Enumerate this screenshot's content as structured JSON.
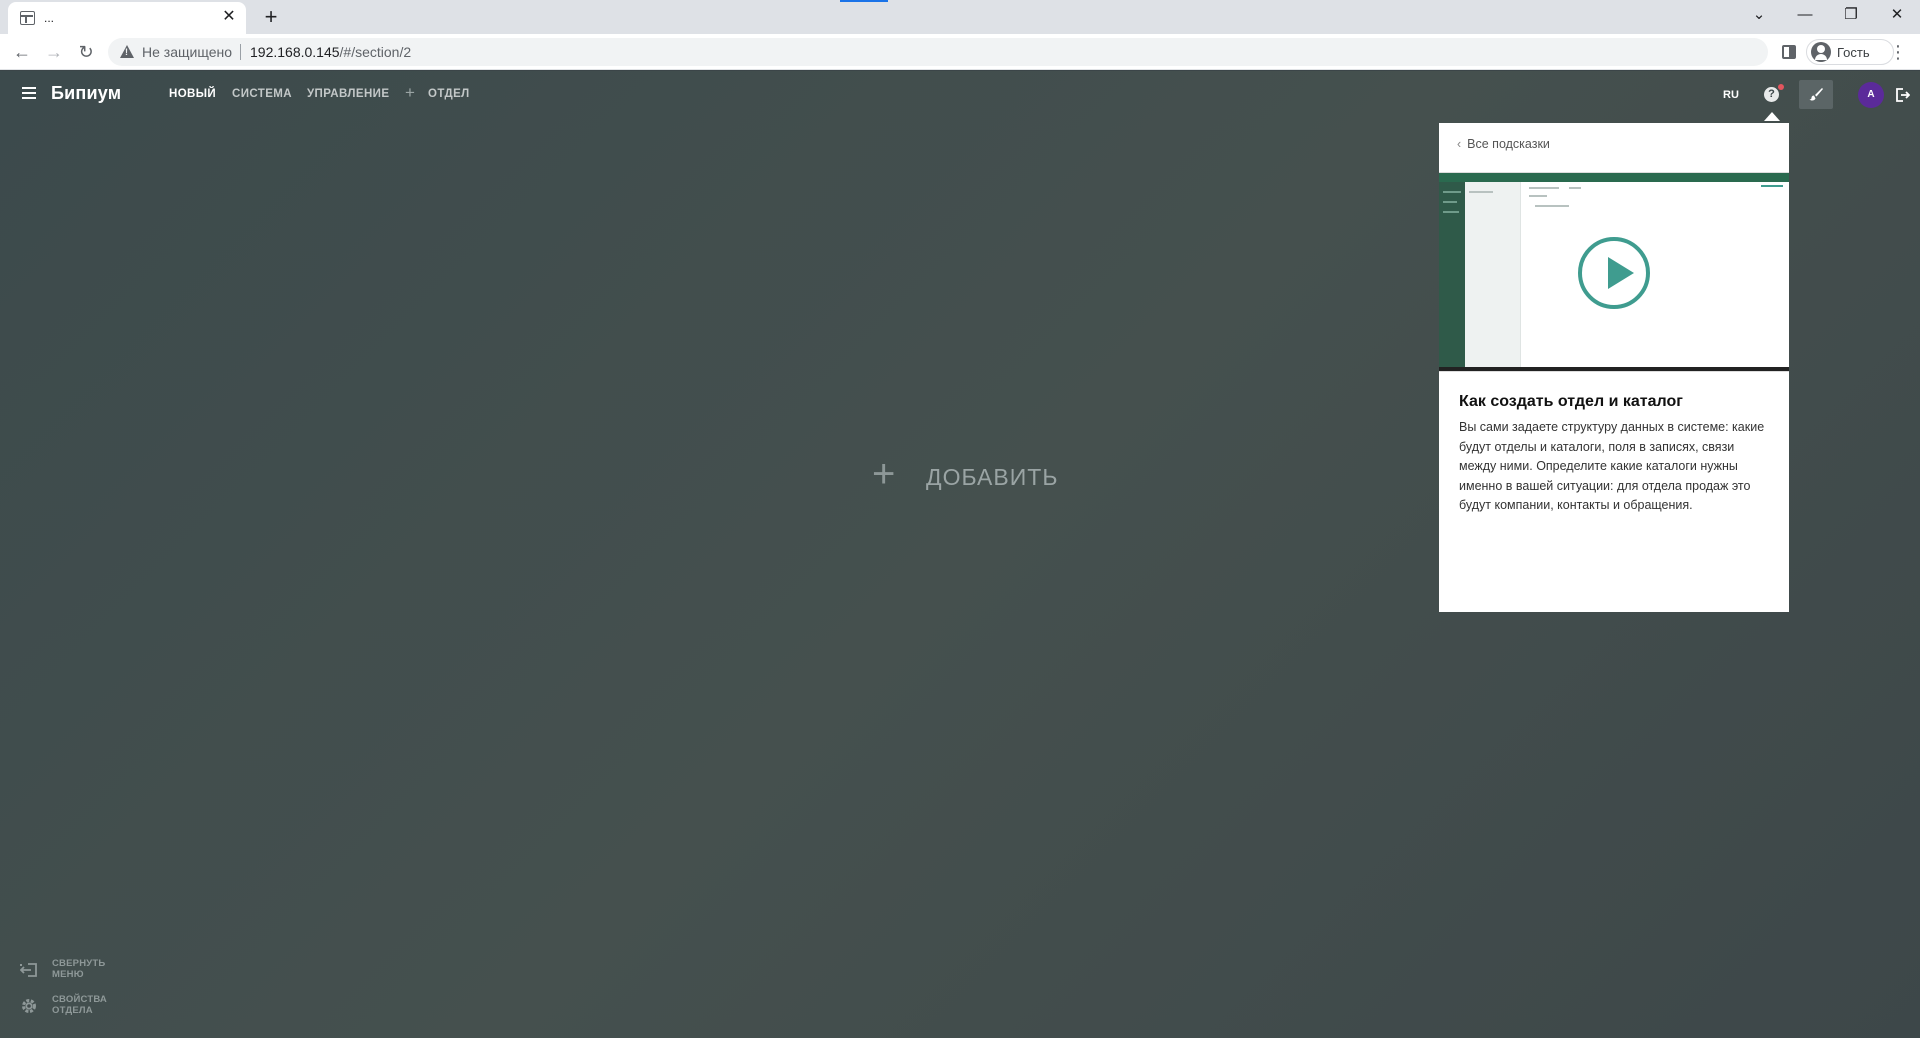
{
  "browser": {
    "tab_title": "...",
    "tab_close": "✕",
    "new_tab": "+",
    "security_label": "Не защищено",
    "url_host": "192.168.0.145",
    "url_path": "/#/section/2",
    "profile_name": "Гость",
    "window_controls": [
      "⌄",
      "—",
      "❐",
      "✕"
    ]
  },
  "app": {
    "logo": "Бипиум",
    "menu": [
      {
        "label": "Новый",
        "active": true
      },
      {
        "label": "Система",
        "active": false
      },
      {
        "label": "Управление",
        "active": false
      },
      {
        "label": "Отдел",
        "active": false
      }
    ],
    "add_section_icon": "plus-icon",
    "lang": "RU",
    "user_initial": "A",
    "help_symbol": "?",
    "accent_color": "#3f9c8f",
    "avatar_color": "#5b2a9a",
    "notification_color": "#e2555e"
  },
  "main": {
    "add_icon": "+",
    "add_label": "ДОБАВИТЬ"
  },
  "sidebar_actions": {
    "collapse_line1": "Свернуть",
    "collapse_line2": "меню",
    "props_line1": "Свойства",
    "props_line2": "отдела"
  },
  "hint": {
    "back_chevron": "‹",
    "back_label": "Все подсказки",
    "title": "Как создать отдел и каталог",
    "text": "Вы сами задаете структуру данных в системе: какие будут отделы и каталоги, поля в записях, связи между ними. Определите какие каталоги нужны именно в вашей ситуации: для отдела продаж это будут компании, контакты и обращения."
  }
}
